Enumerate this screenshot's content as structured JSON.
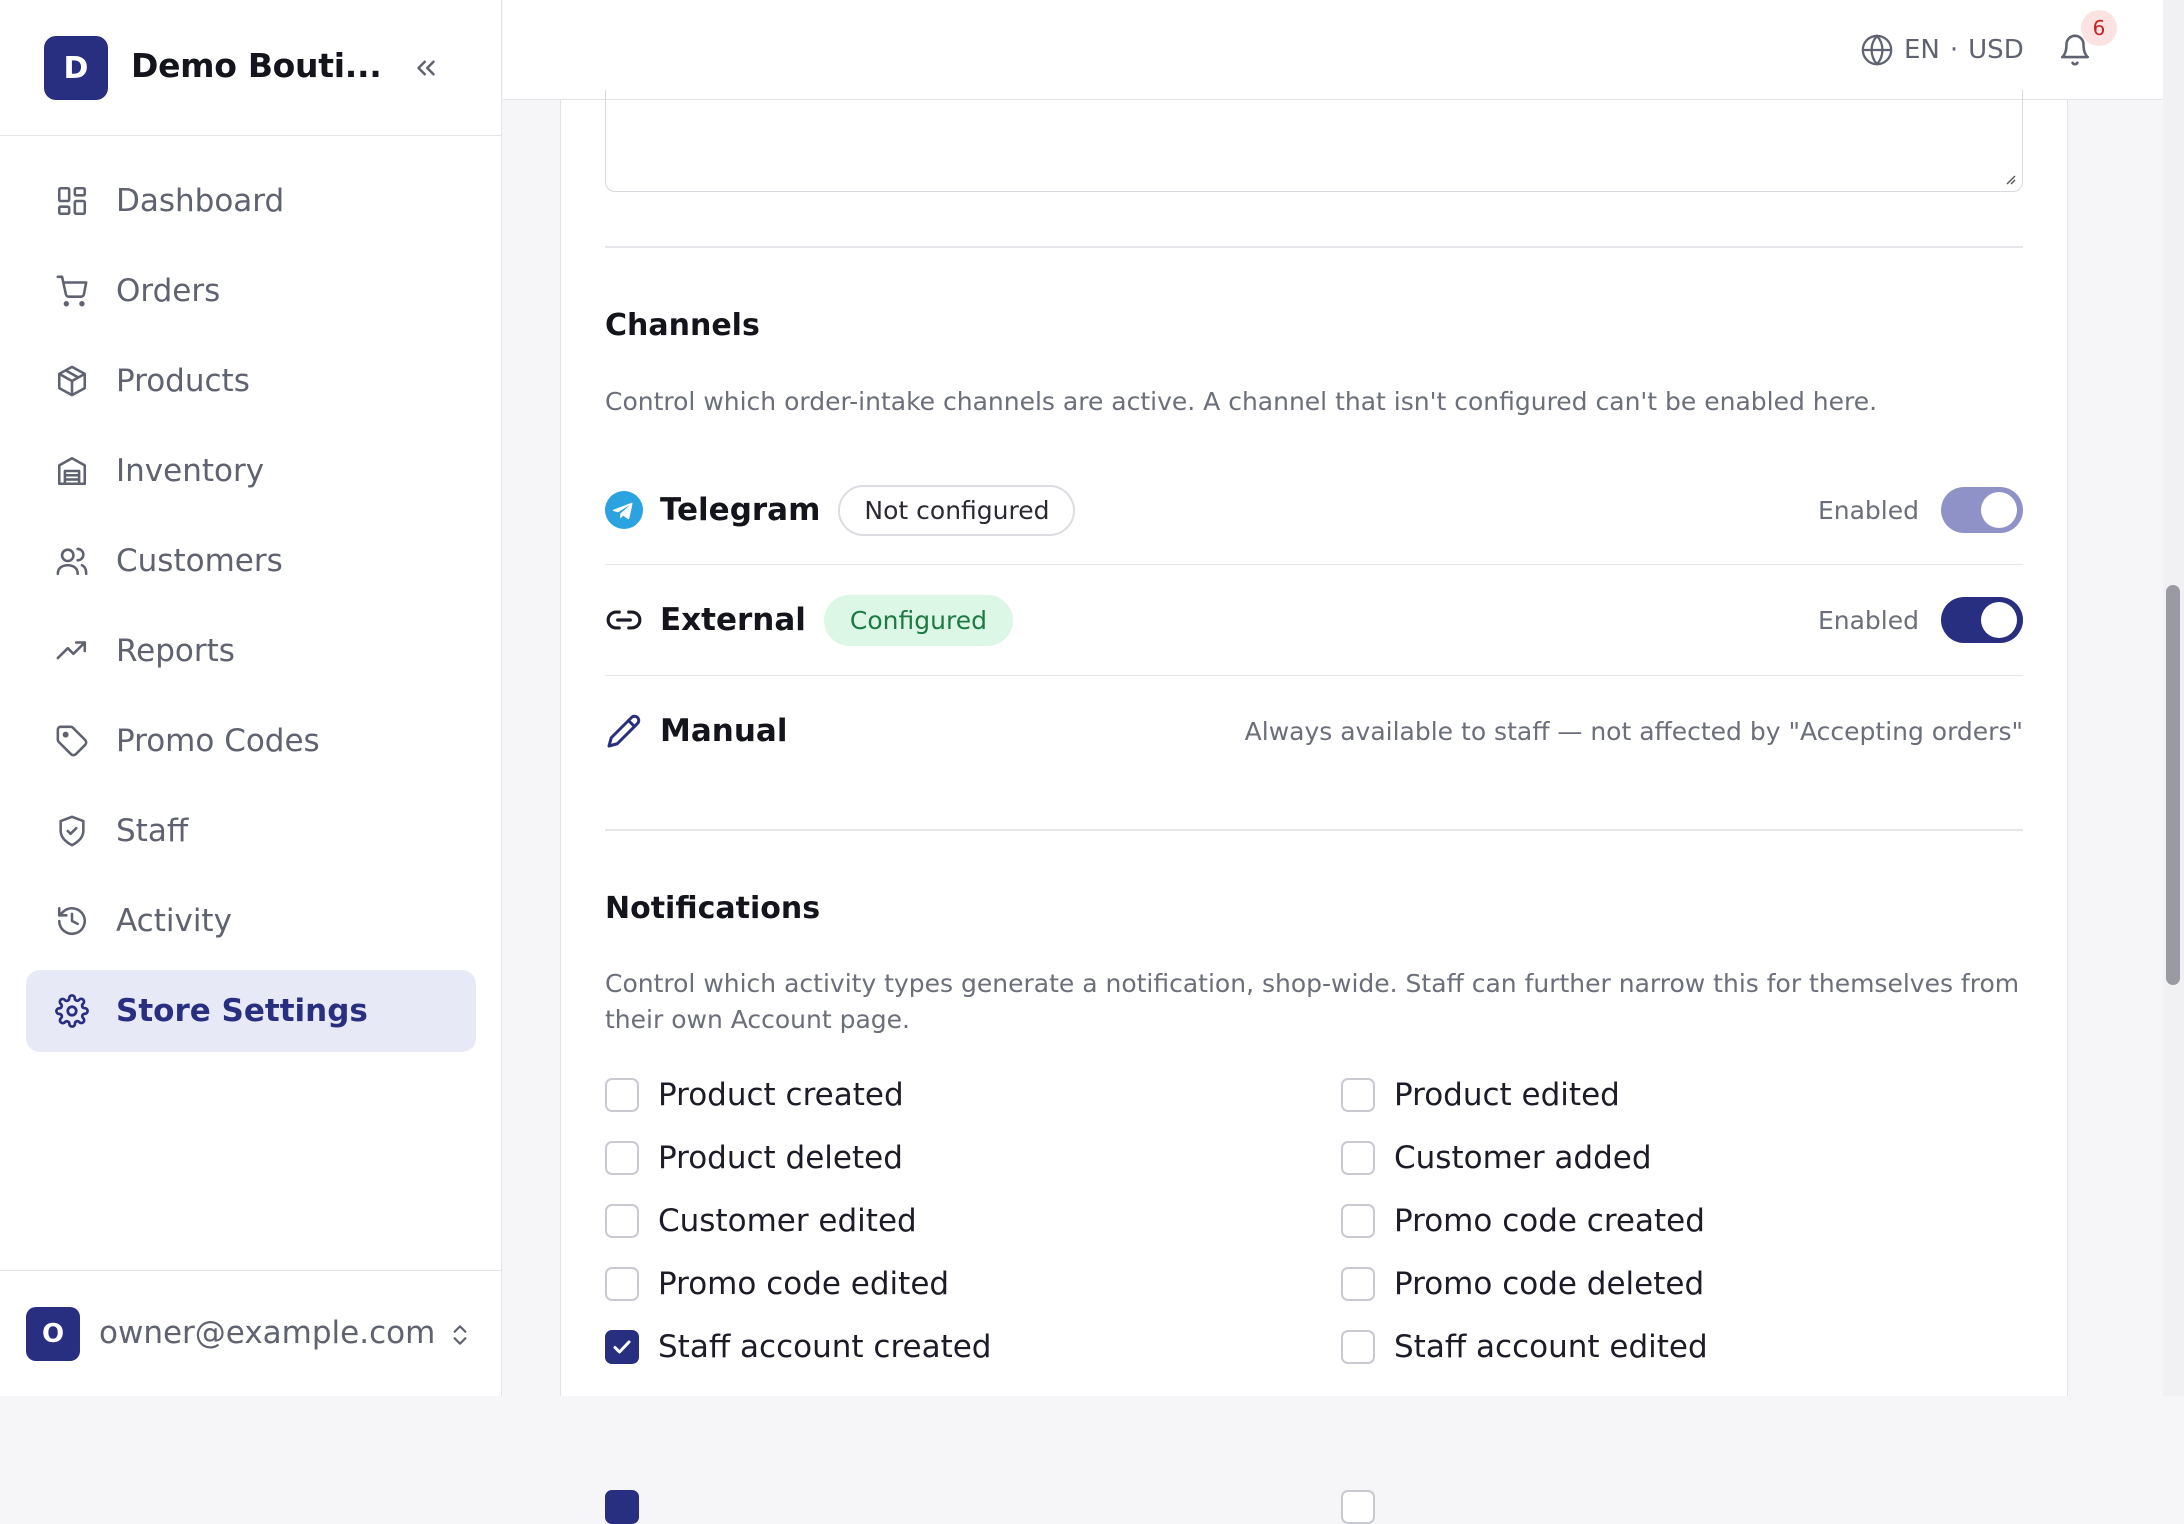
{
  "brand": {
    "initial": "D",
    "name": "Demo Bouti..."
  },
  "sidebar": {
    "items": [
      {
        "label": "Dashboard",
        "icon": "dashboard-icon"
      },
      {
        "label": "Orders",
        "icon": "cart-icon"
      },
      {
        "label": "Products",
        "icon": "box-icon"
      },
      {
        "label": "Inventory",
        "icon": "warehouse-icon"
      },
      {
        "label": "Customers",
        "icon": "users-icon"
      },
      {
        "label": "Reports",
        "icon": "trending-up-icon"
      },
      {
        "label": "Promo Codes",
        "icon": "tag-icon"
      },
      {
        "label": "Staff",
        "icon": "shield-icon"
      },
      {
        "label": "Activity",
        "icon": "history-icon"
      },
      {
        "label": "Store Settings",
        "icon": "gear-icon",
        "active": true
      }
    ]
  },
  "user": {
    "initial": "O",
    "email": "owner@example.com"
  },
  "topbar": {
    "language": "EN",
    "separator": "·",
    "currency": "USD",
    "notification_count": "6"
  },
  "channels": {
    "title": "Channels",
    "description": "Control which order-intake channels are active. A channel that isn't configured can't be enabled here.",
    "rows": [
      {
        "name": "Telegram",
        "badge": "Not configured",
        "status_label": "Enabled",
        "enabled": true,
        "configured": false
      },
      {
        "name": "External",
        "badge": "Configured",
        "status_label": "Enabled",
        "enabled": true,
        "configured": true
      },
      {
        "name": "Manual",
        "note": "Always available to staff — not affected by \"Accepting orders\""
      }
    ]
  },
  "notifications": {
    "title": "Notifications",
    "description": "Control which activity types generate a notification, shop-wide. Staff can further narrow this for themselves from their own Account page.",
    "items": [
      {
        "label": "Product created",
        "checked": false
      },
      {
        "label": "Product edited",
        "checked": false
      },
      {
        "label": "Product deleted",
        "checked": false
      },
      {
        "label": "Customer added",
        "checked": false
      },
      {
        "label": "Customer edited",
        "checked": false
      },
      {
        "label": "Promo code created",
        "checked": false
      },
      {
        "label": "Promo code edited",
        "checked": false
      },
      {
        "label": "Promo code deleted",
        "checked": false
      },
      {
        "label": "Staff account created",
        "checked": true
      },
      {
        "label": "Staff account edited",
        "checked": false
      }
    ]
  },
  "colors": {
    "accent": "#282e80",
    "accent_soft": "#e8e9f6",
    "success_bg": "#dcf7e6",
    "success_text": "#1d7a44",
    "telegram": "#2aa3e0"
  }
}
